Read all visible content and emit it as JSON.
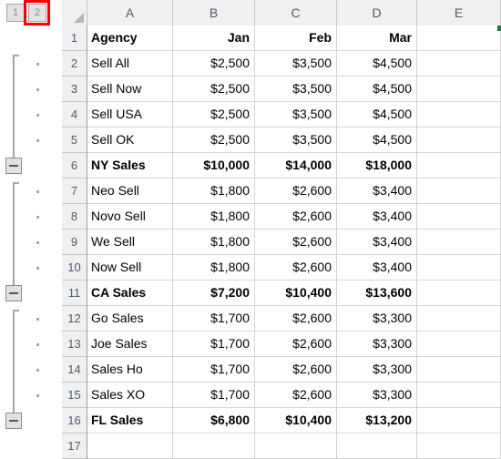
{
  "app": {
    "type": "spreadsheet-grid",
    "accent_selection_color": "#127c48",
    "annotation_color": "#fe0000"
  },
  "outline": {
    "level_buttons": [
      {
        "label": "1",
        "name": "outline-level-1-button"
      },
      {
        "label": "2",
        "name": "outline-level-2-button",
        "highlighted": true
      }
    ],
    "collapse_button_glyph": "minus",
    "groups": [
      {
        "summary_row": 6,
        "detail_rows": [
          2,
          3,
          4,
          5
        ]
      },
      {
        "summary_row": 11,
        "detail_rows": [
          7,
          8,
          9,
          10
        ]
      },
      {
        "summary_row": 16,
        "detail_rows": [
          12,
          13,
          14,
          15
        ]
      }
    ]
  },
  "grid": {
    "column_headers": [
      "A",
      "B",
      "C",
      "D",
      "E"
    ],
    "row_headers": [
      "1",
      "2",
      "3",
      "4",
      "5",
      "6",
      "7",
      "8",
      "9",
      "10",
      "11",
      "12",
      "13",
      "14",
      "15",
      "16",
      "17"
    ],
    "select_all_icon": "corner-triangle-icon"
  },
  "chart_data": {
    "type": "table",
    "title": "",
    "columns": [
      "Agency",
      "Jan",
      "Feb",
      "Mar"
    ],
    "rows": [
      {
        "row": 1,
        "cells": [
          "Agency",
          "Jan",
          "Feb",
          "Mar"
        ],
        "bold": true,
        "kind": "header"
      },
      {
        "row": 2,
        "cells": [
          "Sell All",
          "$2,500",
          "$3,500",
          "$4,500"
        ],
        "bold": false,
        "kind": "detail"
      },
      {
        "row": 3,
        "cells": [
          "Sell Now",
          "$2,500",
          "$3,500",
          "$4,500"
        ],
        "bold": false,
        "kind": "detail"
      },
      {
        "row": 4,
        "cells": [
          "Sell USA",
          "$2,500",
          "$3,500",
          "$4,500"
        ],
        "bold": false,
        "kind": "detail"
      },
      {
        "row": 5,
        "cells": [
          "Sell OK",
          "$2,500",
          "$3,500",
          "$4,500"
        ],
        "bold": false,
        "kind": "detail"
      },
      {
        "row": 6,
        "cells": [
          "NY Sales",
          "$10,000",
          "$14,000",
          "$18,000"
        ],
        "bold": true,
        "kind": "subtotal"
      },
      {
        "row": 7,
        "cells": [
          "Neo Sell",
          "$1,800",
          "$2,600",
          "$3,400"
        ],
        "bold": false,
        "kind": "detail"
      },
      {
        "row": 8,
        "cells": [
          "Novo Sell",
          "$1,800",
          "$2,600",
          "$3,400"
        ],
        "bold": false,
        "kind": "detail"
      },
      {
        "row": 9,
        "cells": [
          "We Sell",
          "$1,800",
          "$2,600",
          "$3,400"
        ],
        "bold": false,
        "kind": "detail"
      },
      {
        "row": 10,
        "cells": [
          "Now Sell",
          "$1,800",
          "$2,600",
          "$3,400"
        ],
        "bold": false,
        "kind": "detail"
      },
      {
        "row": 11,
        "cells": [
          "CA Sales",
          "$7,200",
          "$10,400",
          "$13,600"
        ],
        "bold": true,
        "kind": "subtotal"
      },
      {
        "row": 12,
        "cells": [
          "Go Sales",
          "$1,700",
          "$2,600",
          "$3,300"
        ],
        "bold": false,
        "kind": "detail"
      },
      {
        "row": 13,
        "cells": [
          "Joe Sales",
          "$1,700",
          "$2,600",
          "$3,300"
        ],
        "bold": false,
        "kind": "detail"
      },
      {
        "row": 14,
        "cells": [
          "Sales Ho",
          "$1,700",
          "$2,600",
          "$3,300"
        ],
        "bold": false,
        "kind": "detail"
      },
      {
        "row": 15,
        "cells": [
          "Sales XO",
          "$1,700",
          "$2,600",
          "$3,300"
        ],
        "bold": false,
        "kind": "detail"
      },
      {
        "row": 16,
        "cells": [
          "FL Sales",
          "$6,800",
          "$10,400",
          "$13,200"
        ],
        "bold": true,
        "kind": "subtotal"
      },
      {
        "row": 17,
        "cells": [
          "",
          "",
          "",
          ""
        ],
        "bold": false,
        "kind": "empty"
      }
    ]
  }
}
